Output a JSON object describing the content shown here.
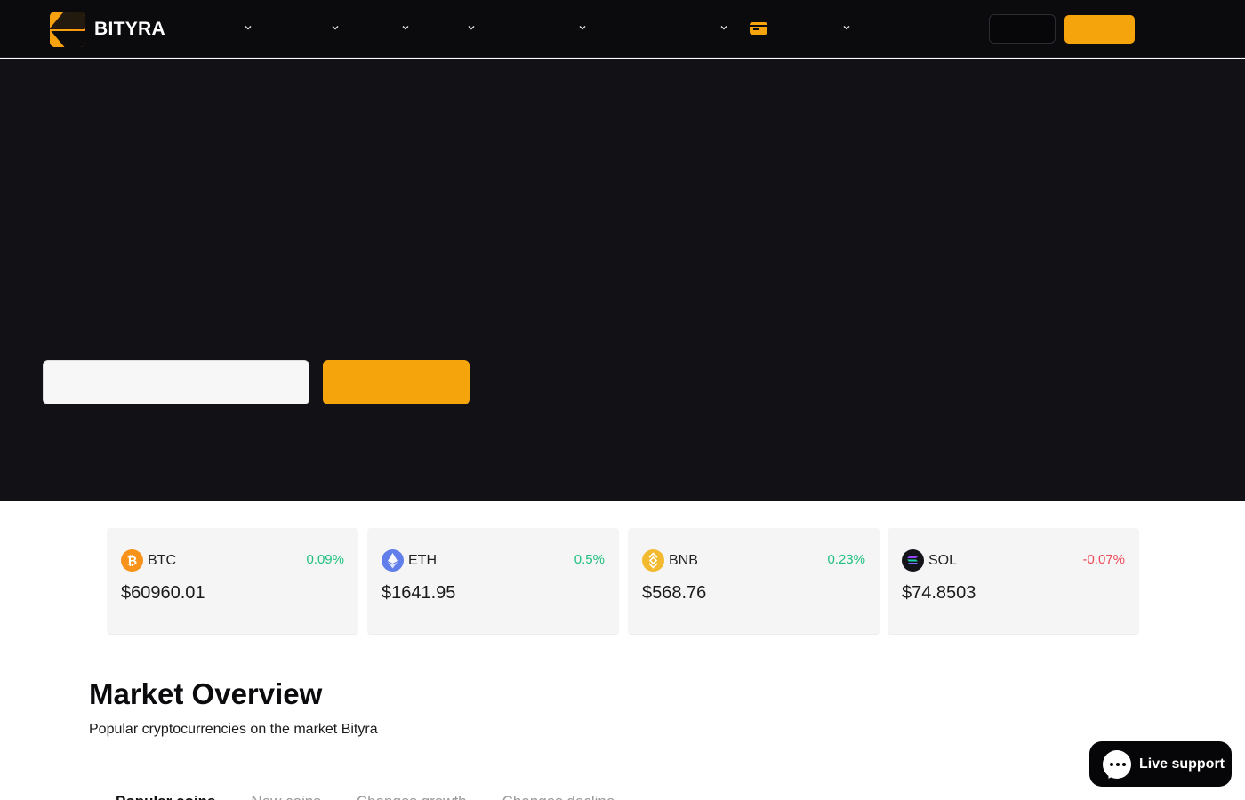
{
  "header": {
    "brand": "BITYRA",
    "nav_chevrons": 7,
    "login_label": "",
    "signup_label": ""
  },
  "hero": {
    "input_placeholder": "",
    "cta_label": ""
  },
  "tickers": [
    {
      "symbol": "BTC",
      "change": "0.09%",
      "price": "$60960.01",
      "direction": "up",
      "color": "#f7931a",
      "icon": "bitcoin-icon"
    },
    {
      "symbol": "ETH",
      "change": "0.5%",
      "price": "$1641.95",
      "direction": "up",
      "color": "#627eea",
      "icon": "ethereum-icon"
    },
    {
      "symbol": "BNB",
      "change": "0.23%",
      "price": "$568.76",
      "direction": "up",
      "color": "#f3ba2f",
      "icon": "bnb-icon"
    },
    {
      "symbol": "SOL",
      "change": "-0.07%",
      "price": "$74.8503",
      "direction": "down",
      "color": "#14151a",
      "icon": "solana-icon"
    }
  ],
  "market_overview": {
    "title": "Market Overview",
    "subtitle": "Popular cryptocurrencies on the market Bityra",
    "tabs": [
      {
        "label": "Popular coins",
        "active": true
      },
      {
        "label": "New coins",
        "active": false
      },
      {
        "label": "Changes growth",
        "active": false
      },
      {
        "label": "Changes decline",
        "active": false
      }
    ]
  },
  "live_support": {
    "label": "Live support"
  },
  "colors": {
    "accent": "#f5a40c",
    "header_bg": "#0b0b0e",
    "hero_bg": "#121116",
    "up": "#1fbf7f",
    "down": "#ec4b5a"
  }
}
